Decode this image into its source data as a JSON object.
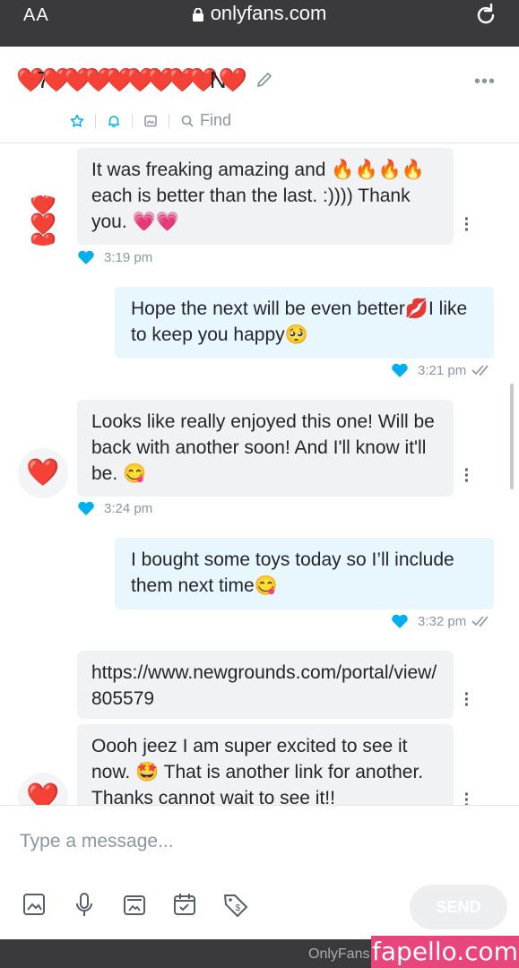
{
  "browser": {
    "text_size_label": "AA",
    "url": "onlyfans.com",
    "bottom_label": "OnlyFans"
  },
  "header": {
    "contact_name": "❤️7❤️❤️❤️❤️❤️❤️❤️❤️N❤️",
    "tabs": [
      {
        "icon": "star-icon"
      },
      {
        "icon": "bell-icon"
      },
      {
        "icon": "image-icon"
      },
      {
        "icon": "search-icon",
        "label": "Find"
      }
    ]
  },
  "messages": [
    {
      "direction": "in",
      "avatar": "❤️❤️❤️",
      "text": "It was freaking amazing and 🔥🔥🔥🔥 each is better than the last. :)))) Thank you. 💗💗",
      "time": "3:19 pm"
    },
    {
      "direction": "out",
      "text": "Hope the next will be even better💋I like to keep you happy🥺",
      "time": "3:21 pm"
    },
    {
      "direction": "in",
      "avatar": "❤️",
      "text": "Looks like really enjoyed this one! Will be back with another soon! And I'll know it'll be. 😋",
      "time": "3:24 pm"
    },
    {
      "direction": "out",
      "text": "I bought some toys today so I’ll include them next time😋",
      "time": "3:32 pm"
    },
    {
      "direction": "in",
      "text": "https://www.newgrounds.com/portal/view/805579"
    },
    {
      "direction": "in",
      "avatar": "❤️",
      "text": "Oooh jeez I am super excited to see it now. 🤩 That is another link for another. Thanks cannot wait to see it!!"
    }
  ],
  "composer": {
    "placeholder": "Type a message...",
    "send_label": "SEND",
    "tools": [
      "image-icon",
      "microphone-icon",
      "media-vault-icon",
      "calendar-check-icon",
      "price-tag-icon"
    ]
  },
  "watermark": "fapello.com",
  "colors": {
    "accent": "#00aff0",
    "incoming_bubble": "#f0f2f4",
    "outgoing_bubble": "#e8f6fd",
    "muted": "#8a96a3"
  }
}
